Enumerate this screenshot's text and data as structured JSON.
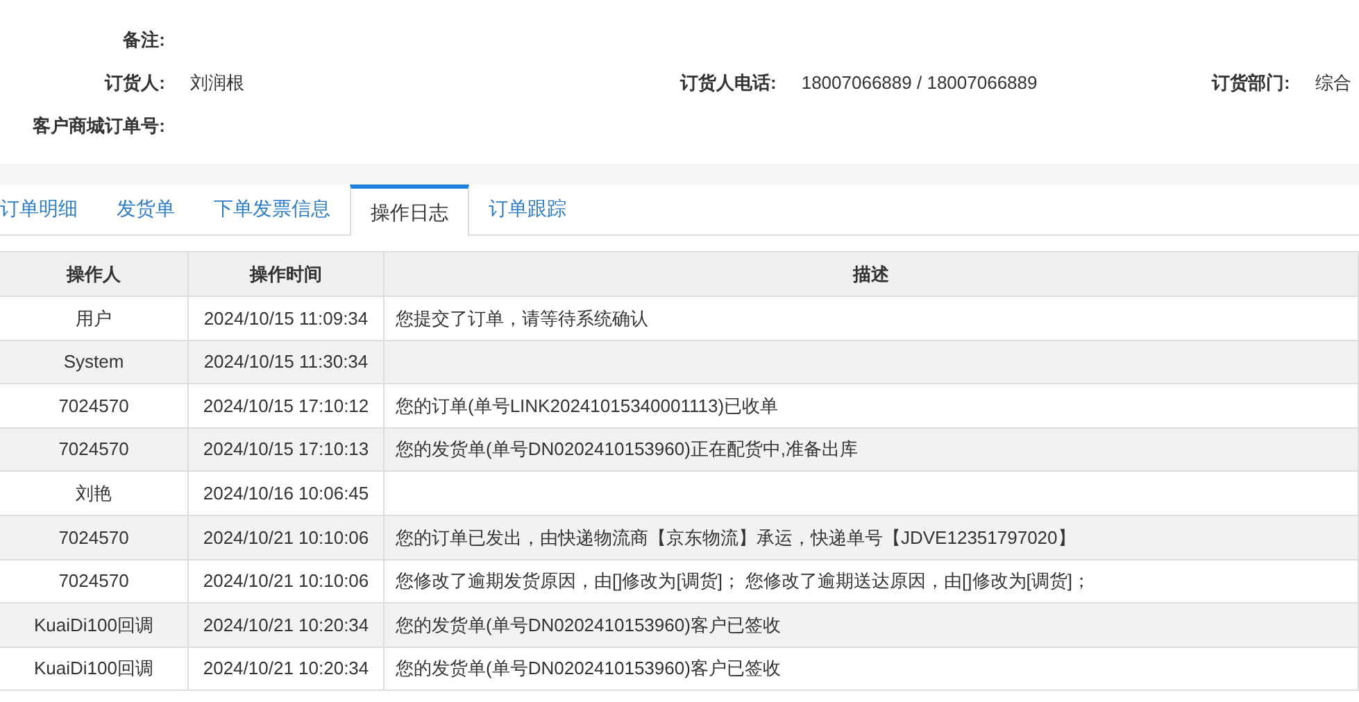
{
  "info_rows": [
    [
      {
        "label": "备注:"
      }
    ],
    [
      {
        "label": "订货人:",
        "value": "刘润根"
      },
      {
        "label": "订货人电话:",
        "value": "18007066889 / 18007066889"
      },
      {
        "label": "订货部门:",
        "value": "综合"
      }
    ],
    [
      {
        "label": "客户商城订单号:"
      }
    ]
  ],
  "tabs": [
    {
      "label": "订单明细",
      "selected": false
    },
    {
      "label": "发货单",
      "selected": false
    },
    {
      "label": "下单发票信息",
      "selected": false
    },
    {
      "label": "操作日志",
      "selected": true
    },
    {
      "label": "订单跟踪",
      "selected": false
    }
  ],
  "table": {
    "columns": [
      "操作人",
      "操作时间",
      "描述"
    ],
    "rows": [
      [
        "用户",
        "2024/10/15 11:09:34",
        "您提交了订单，请等待系统确认"
      ],
      [
        "System",
        "2024/10/15 11:30:34",
        ""
      ],
      [
        "7024570",
        "2024/10/15 17:10:12",
        "您的订单(单号LINK20241015340001113)已收单"
      ],
      [
        "7024570",
        "2024/10/15 17:10:13",
        "您的发货单(单号DN0202410153960)正在配货中,准备出库"
      ],
      [
        "刘艳",
        "2024/10/16 10:06:45",
        ""
      ],
      [
        "7024570",
        "2024/10/21 10:10:06",
        "您的订单已发出，由快递物流商【京东物流】承运，快递单号【JDVE12351797020】"
      ],
      [
        "7024570",
        "2024/10/21 10:10:06",
        "您修改了逾期发货原因，由[]修改为[调货]；  您修改了逾期送达原因，由[]修改为[调货]；"
      ],
      [
        "KuaiDi100回调",
        "2024/10/21 10:20:34",
        "您的发货单(单号DN0202410153960)客户已签收"
      ],
      [
        "KuaiDi100回调",
        "2024/10/21 10:20:34",
        "您的发货单(单号DN0202410153960)客户已签收"
      ]
    ]
  }
}
